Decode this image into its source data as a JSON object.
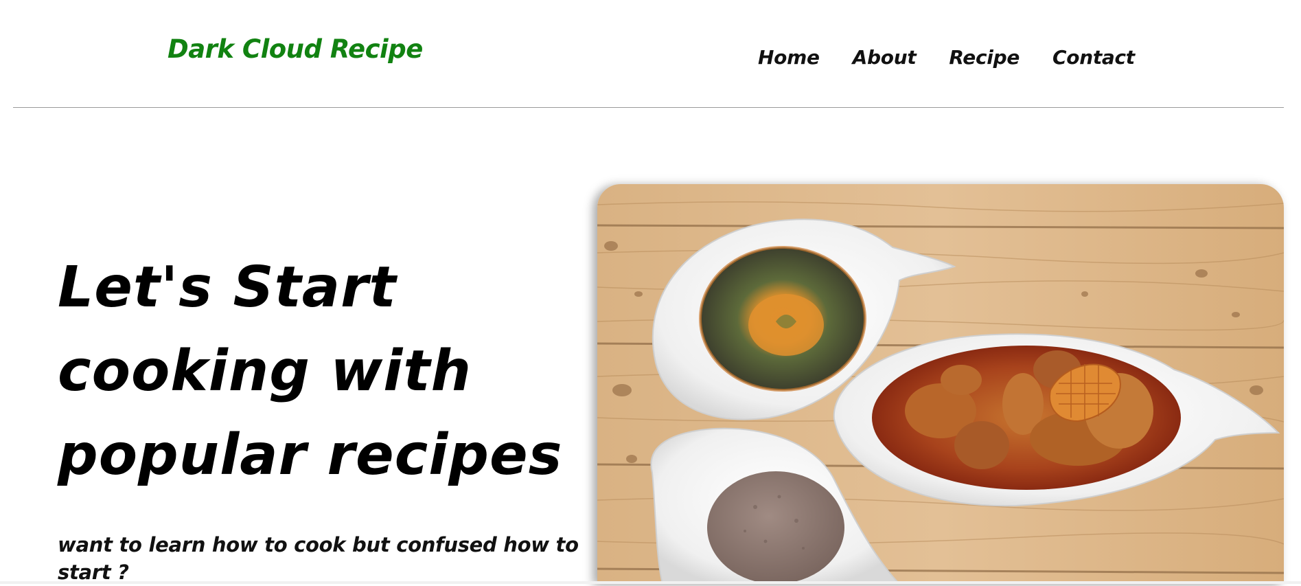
{
  "header": {
    "logo": "Dark Cloud Recipe",
    "nav": [
      {
        "label": "Home"
      },
      {
        "label": "About"
      },
      {
        "label": "Recipe"
      },
      {
        "label": "Contact"
      }
    ]
  },
  "hero": {
    "title_lines": [
      "Let's Start",
      "cooking with",
      "popular recipes"
    ],
    "subtitle": "want to learn how to cook but confused how to start ?",
    "image": {
      "depicts": "food-photo"
    }
  },
  "colors": {
    "logo": "#118211",
    "text": "#000000",
    "background": "#ffffff",
    "divider": "#9a9a9a"
  }
}
